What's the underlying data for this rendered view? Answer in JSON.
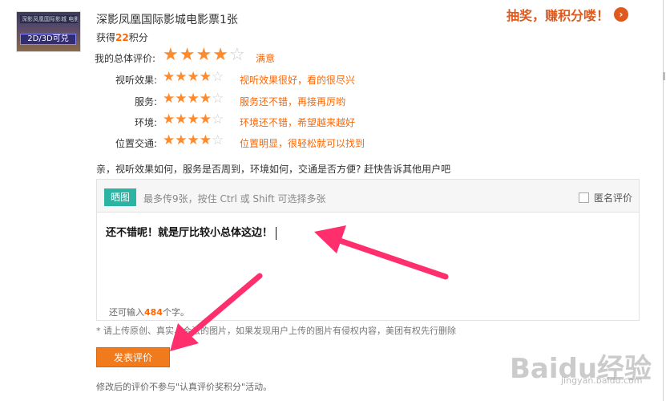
{
  "product": {
    "title": "深影凤凰国际影城电影票1张",
    "points_prefix": "获得",
    "points_value": "22",
    "points_suffix": "积分",
    "thumb_caption": "2D/3D可兑",
    "thumb_header": "深影凤凰国际影城 电影票"
  },
  "promo": {
    "text": "抽奖，赚积分喽！",
    "icon": "chevron-right-icon"
  },
  "ratings": {
    "overall": {
      "label": "我的总体评价:",
      "stars": 4,
      "max": 5,
      "text": "满意"
    },
    "items": [
      {
        "label": "视听效果:",
        "stars": 4,
        "max": 5,
        "text": "视听效果很好，看的很尽兴"
      },
      {
        "label": "服务:",
        "stars": 4,
        "max": 5,
        "text": "服务还不错，再接再厉哟"
      },
      {
        "label": "环境:",
        "stars": 4,
        "max": 5,
        "text": "环境还不错，希望越来越好"
      },
      {
        "label": "位置交通:",
        "stars": 4,
        "max": 5,
        "text": "位置明显，很轻松就可以找到"
      }
    ]
  },
  "prompt": "亲，视听效果如何，服务是否周到，环境如何，交通是否方便? 赶快告诉其他用户吧",
  "editor": {
    "upload_label": "晒图",
    "upload_hint": "最多传9张，按住 Ctrl 或 Shift 可选择多张",
    "anonymous_label": "匿名评价",
    "anonymous_checked": false,
    "content": "还不错呢！就是厅比较小总体这边！",
    "remain_prefix": "还可输入",
    "remain_value": "484",
    "remain_suffix": "个字。"
  },
  "notice": "* 请上传原创、真实、合法的图片，如果发现用户上传的图片有侵权内容，美团有权先行删除",
  "submit_label": "发表评价",
  "footnote": "修改后的评价不参与\"认真评价奖积分\"活动。",
  "watermark": {
    "logo": "Baidu经验",
    "url": "jingyan.baidu.com"
  },
  "colors": {
    "accent": "#f07a1c",
    "star": "#ff8a2b",
    "teal": "#2bb3a3",
    "arrow": "#ff2f6e"
  }
}
